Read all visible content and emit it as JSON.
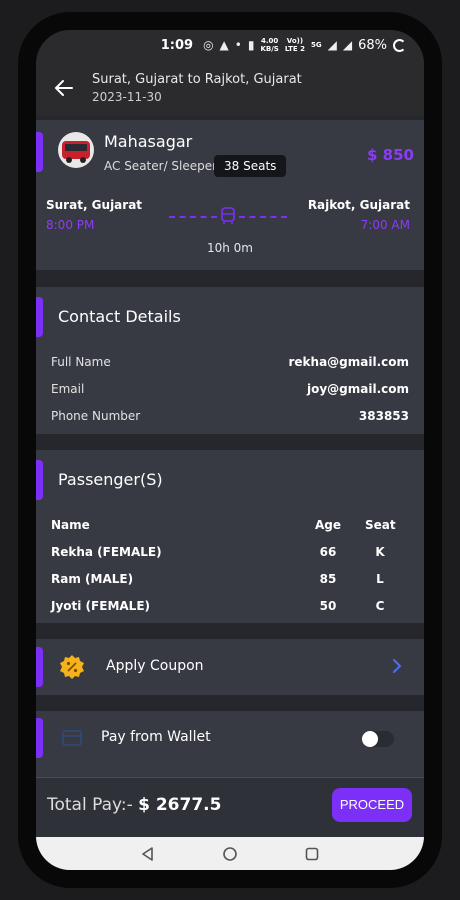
{
  "status_bar": {
    "time": "1:09",
    "net_speed_top": "4.00",
    "net_speed_bottom": "KB/S",
    "vo_top": "Vo))",
    "vo_bottom": "LTE 2",
    "lte": "5G",
    "battery": "68%"
  },
  "header": {
    "route": "Surat, Gujarat  to  Rajkot, Gujarat",
    "date": "2023-11-30"
  },
  "bus": {
    "name": "Mahasagar",
    "type": "AC Seater/ Sleeper",
    "seats": "38 Seats",
    "price": "$ 850",
    "from_city": "Surat, Gujarat",
    "from_time": "8:00 PM",
    "to_city": "Rajkot, Gujarat",
    "to_time": "7:00 AM",
    "duration": "10h 0m"
  },
  "contact": {
    "title": "Contact Details",
    "rows": [
      {
        "label": "Full Name",
        "value": "rekha@gmail.com"
      },
      {
        "label": "Email",
        "value": "joy@gmail.com"
      },
      {
        "label": "Phone Number",
        "value": "383853"
      }
    ]
  },
  "passengers": {
    "title": "Passenger(S)",
    "headers": {
      "name": "Name",
      "age": "Age",
      "seat": "Seat"
    },
    "rows": [
      {
        "name": "Rekha (FEMALE)",
        "age": "66",
        "seat": "K"
      },
      {
        "name": "Ram (MALE)",
        "age": "85",
        "seat": "L"
      },
      {
        "name": "Jyoti (FEMALE)",
        "age": "50",
        "seat": "C"
      }
    ]
  },
  "coupon": {
    "label": "Apply Coupon"
  },
  "wallet": {
    "label": "Pay from Wallet",
    "enabled": false
  },
  "footer": {
    "total_label": "Total Pay:-",
    "total_value": "$ 2677.5",
    "proceed_label": "PROCEED"
  },
  "colors": {
    "accent": "#7b2ff7",
    "card": "#383a43",
    "background": "#25272d",
    "coupon_icon": "#f5b21b"
  }
}
